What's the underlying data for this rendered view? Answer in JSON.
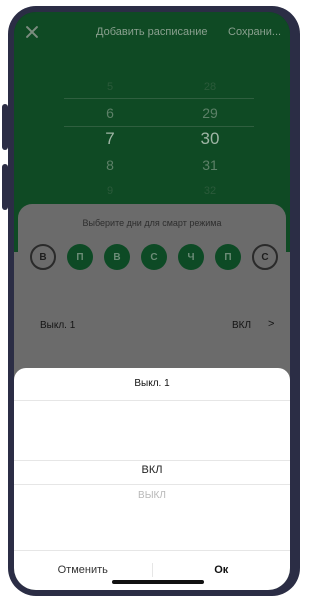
{
  "header": {
    "title": "Добавить расписание",
    "save_label": "Сохрани..."
  },
  "time_picker": {
    "hours": [
      "5",
      "6",
      "7",
      "8",
      "9"
    ],
    "minutes": [
      "28",
      "29",
      "30",
      "31",
      "32"
    ],
    "selected_hour": "7",
    "selected_minute": "30"
  },
  "days_section": {
    "title": "Выберите дни для смарт режима",
    "days": [
      {
        "label": "В",
        "active": false
      },
      {
        "label": "П",
        "active": true
      },
      {
        "label": "В",
        "active": true
      },
      {
        "label": "С",
        "active": true
      },
      {
        "label": "Ч",
        "active": true
      },
      {
        "label": "П",
        "active": true
      },
      {
        "label": "С",
        "active": false
      }
    ]
  },
  "setting_row": {
    "label": "Выкл. 1",
    "value": "ВКЛ",
    "chevron": ">"
  },
  "sheet": {
    "title": "Выкл. 1",
    "options": [
      "ВКЛ",
      "ВЫКЛ"
    ],
    "cancel_label": "Отменить",
    "ok_label": "Ок"
  },
  "colors": {
    "frame": "#2b2d45",
    "app_green": "#0f4a24",
    "active_day": "#0d4a25",
    "dim_overlay": "#6b6b6b",
    "sheet_bg": "#ffffff"
  }
}
